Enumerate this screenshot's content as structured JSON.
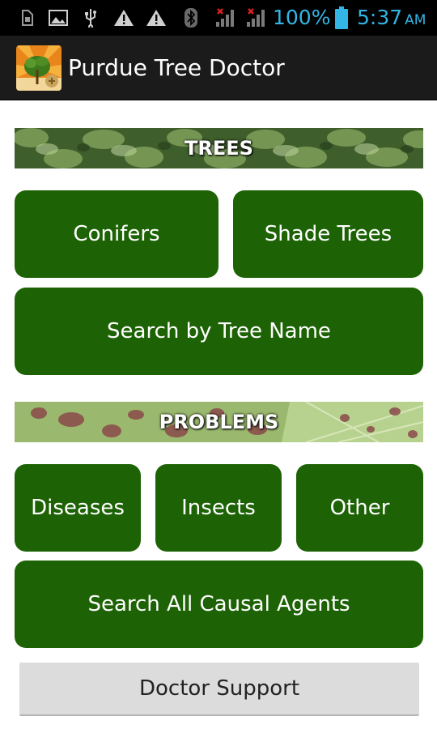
{
  "status_bar": {
    "battery_percent": "100%",
    "time": "5:37",
    "ampm": "AM"
  },
  "app": {
    "title": "Purdue Tree Doctor"
  },
  "trees_section": {
    "banner": "TREES",
    "buttons": {
      "conifers": "Conifers",
      "shade_trees": "Shade Trees",
      "search_by_name": "Search by Tree Name"
    }
  },
  "problems_section": {
    "banner": "PROBLEMS",
    "buttons": {
      "diseases": "Diseases",
      "insects": "Insects",
      "other": "Other",
      "search_all": "Search All Causal Agents"
    }
  },
  "footer": {
    "doctor_support": "Doctor Support"
  },
  "colors": {
    "button_green": "#1d6305",
    "status_blue": "#33b5e5",
    "action_bar": "#1b1b1b",
    "support_button": "#dcdcdc"
  }
}
